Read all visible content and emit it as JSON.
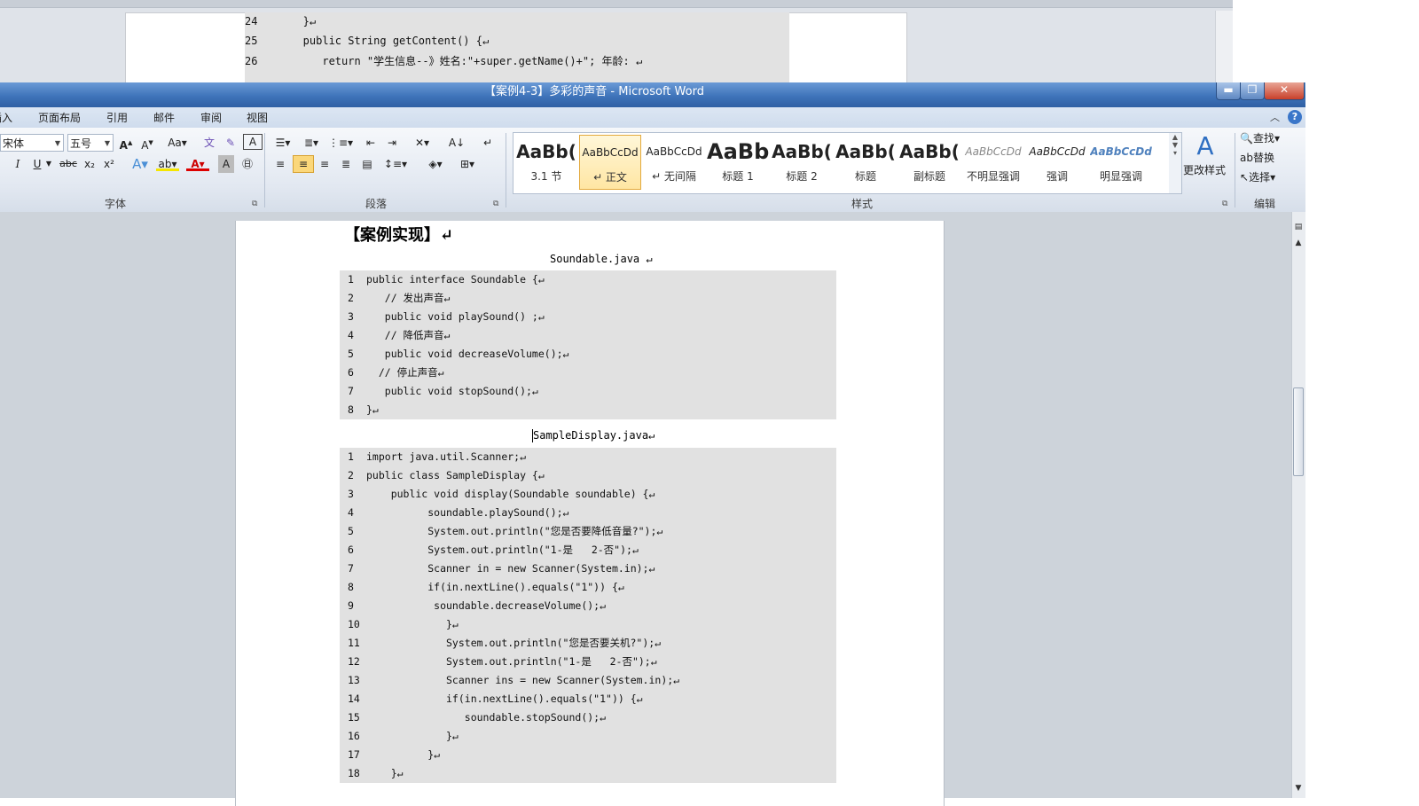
{
  "background_window": {
    "code_lines": [
      {
        "num": "24",
        "text": "   }↵"
      },
      {
        "num": "25",
        "text": "   public String getContent() {↵"
      },
      {
        "num": "26",
        "text": "      return \"学生信息--》姓名:\"+super.getName()+\"; 年龄: ↵"
      }
    ]
  },
  "window": {
    "title": "【案例4-3】多彩的声音 - Microsoft Word",
    "min_label": "▬",
    "max_label": "❐",
    "close_label": "✕"
  },
  "tabs": [
    "插入",
    "页面布局",
    "引用",
    "邮件",
    "审阅",
    "视图"
  ],
  "help_label": "?",
  "ribbon": {
    "font_name": "宋体",
    "font_size": "五号",
    "groups": {
      "font": "字体",
      "paragraph": "段落",
      "styles": "样式",
      "editing": "编辑"
    },
    "styles": [
      {
        "sample": "AaBb(",
        "name": "3.1 节"
      },
      {
        "sample": "AaBbCcDd",
        "name": "↵ 正文"
      },
      {
        "sample": "AaBbCcDd",
        "name": "↵ 无间隔"
      },
      {
        "sample": "AaBb",
        "name": "标题 1"
      },
      {
        "sample": "AaBb(",
        "name": "标题 2"
      },
      {
        "sample": "AaBb(",
        "name": "标题"
      },
      {
        "sample": "AaBb(",
        "name": "副标题"
      },
      {
        "sample": "AaBbCcDd",
        "name": "不明显强调"
      },
      {
        "sample": "AaBbCcDd",
        "name": "强调"
      },
      {
        "sample": "AaBbCcDd",
        "name": "明显强调"
      }
    ],
    "change_styles": "更改样式",
    "find": "查找",
    "replace": "替换",
    "select": "选择"
  },
  "document": {
    "heading": "【案例实现】↵",
    "file1": "Soundable.java ↵",
    "code1": [
      {
        "num": "1",
        "text": "public interface Soundable {↵"
      },
      {
        "num": "2",
        "text": "   // 发出声音↵"
      },
      {
        "num": "3",
        "text": "   public void playSound() ;↵"
      },
      {
        "num": "4",
        "text": "   // 降低声音↵"
      },
      {
        "num": "5",
        "text": "   public void decreaseVolume();↵"
      },
      {
        "num": "6",
        "text": "  // 停止声音↵"
      },
      {
        "num": "7",
        "text": "   public void stopSound();↵"
      },
      {
        "num": "8",
        "text": "}↵"
      }
    ],
    "file2": "SampleDisplay.java↵",
    "code2": [
      {
        "num": "1",
        "text": "import java.util.Scanner;↵"
      },
      {
        "num": "2",
        "text": "public class SampleDisplay {↵"
      },
      {
        "num": "3",
        "text": "    public void display(Soundable soundable) {↵"
      },
      {
        "num": "4",
        "text": "          soundable.playSound();↵"
      },
      {
        "num": "5",
        "text": "          System.out.println(\"您是否要降低音量?\");↵"
      },
      {
        "num": "6",
        "text": "          System.out.println(\"1-是   2-否\");↵"
      },
      {
        "num": "7",
        "text": "          Scanner in = new Scanner(System.in);↵"
      },
      {
        "num": "8",
        "text": "          if(in.nextLine().equals(\"1\")) {↵"
      },
      {
        "num": "9",
        "text": "           soundable.decreaseVolume();↵"
      },
      {
        "num": "10",
        "text": "             }↵"
      },
      {
        "num": "11",
        "text": "             System.out.println(\"您是否要关机?\");↵"
      },
      {
        "num": "12",
        "text": "             System.out.println(\"1-是   2-否\");↵"
      },
      {
        "num": "13",
        "text": "             Scanner ins = new Scanner(System.in);↵"
      },
      {
        "num": "14",
        "text": "             if(in.nextLine().equals(\"1\")) {↵"
      },
      {
        "num": "15",
        "text": "                soundable.stopSound();↵"
      },
      {
        "num": "16",
        "text": "             }↵"
      },
      {
        "num": "17",
        "text": "          }↵"
      },
      {
        "num": "18",
        "text": "    }↵"
      }
    ]
  },
  "colors": {
    "title_gradient_top": "#6a9ad6",
    "selected_style": "#ffe6a3",
    "code_background": "#e1e1e1"
  }
}
